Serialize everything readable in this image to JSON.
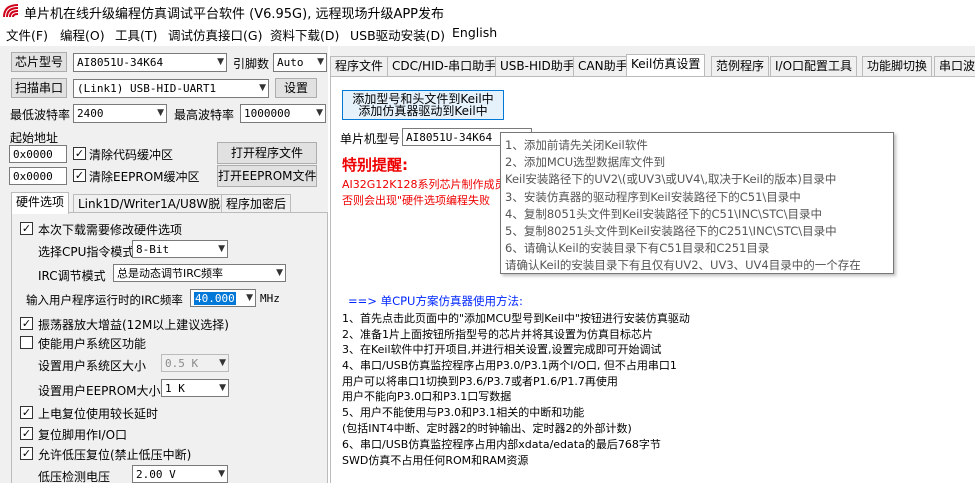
{
  "window": {
    "title": "单片机在线升级编程仿真调试平台软件 (V6.95G), 远程现场升级APP发布"
  },
  "menu": [
    "文件(F)",
    "编程(O)",
    "工具(T)",
    "调试仿真接口(G)",
    "资料下载(D)",
    "USB驱动安装(D)",
    "English"
  ],
  "left": {
    "chip_btn": "芯片型号",
    "chip_value": "AI8051U-34K64",
    "pins_label": "引脚数",
    "pins_value": "Auto",
    "scan_btn": "扫描串口",
    "port_value": "(Link1) USB-HID-UART1",
    "settings_btn": "设置",
    "min_baud_label": "最低波特率",
    "min_baud": "2400",
    "max_baud_label": "最高波特率",
    "max_baud": "1000000",
    "start_addr_label": "起始地址",
    "addr1": "0x0000",
    "clear_code": "清除代码缓冲区",
    "open_prog": "打开程序文件",
    "addr2": "0x0000",
    "clear_eeprom": "清除EEPROM缓冲区",
    "open_eeprom": "打开EEPROM文件",
    "subtabs": [
      "硬件选项",
      "Link1D/Writer1A/U8W脱机",
      "程序加密后"
    ],
    "opt_modify": "本次下载需要修改硬件选项",
    "cpu_label": "选择CPU指令模式",
    "cpu_value": "8-Bit",
    "irc_label": "IRC调节模式",
    "irc_value": "总是动态调节IRC频率",
    "freq_label": "输入用户程序运行时的IRC频率",
    "freq_value": "40.000",
    "freq_unit": "MHz",
    "amp": "振荡器放大增益(12M以上建议选择)",
    "sys_area": "使能用户系统区功能",
    "sys_size_label": "设置用户系统区大小",
    "sys_size": "0.5 K",
    "eeprom_label": "设置用户EEPROM大小",
    "eeprom_size": "1   K",
    "long_delay": "上电复位使用较长延时",
    "reset_io": "复位脚用作I/O口",
    "lvr": "允许低压复位(禁止低压中断)",
    "lv_label": "低压检测电压",
    "lv_value": "2.00 V"
  },
  "right": {
    "tabs": [
      "程序文件",
      "CDC/HID-串口助手",
      "USB-HID助手",
      "CAN助手",
      "Keil仿真设置",
      "范例程序",
      "I/O口配置工具",
      "功能脚切换",
      "串口波"
    ],
    "add_btn_line1": "添加型号和头文件到Keil中",
    "add_btn_line2": "添加仿真器驱动到Keil中",
    "mcu_label": "单片机型号",
    "mcu_value": "AI8051U-34K64",
    "warn_title": "特别提醒:",
    "warn_line1": "AI32G12K128系列芯片制作成员",
    "warn_line2": "否则会出现\"硬件选项编程失败",
    "method": "==> 单CPU方案仿真器使用方法:",
    "steps": [
      "1、首先点击此页面中的\"添加MCU型号到Keil中\"按钮进行安装仿真驱动",
      "2、准备1片上面按钮所指型号的芯片并将其设置为仿真目标芯片",
      "3、在Keil软件中打开项目,并进行相关设置,设置完成即可开始调试",
      "4、串口/USB仿真监控程序占用P3.0/P3.1两个I/O口, 但不占用串口1",
      "    用户可以将串口1切换到P3.6/P3.7或者P1.6/P1.7再使用",
      "    用户不能向P3.0口和P3.1口写数据",
      "5、用户不能使用与P3.0和P3.1相关的中断和功能",
      "    (包括INT4中断、定时器2的时钟输出、定时器2的外部计数)",
      "6、串口/USB仿真监控程序占用内部xdata/edata的最后768字节",
      "    SWD仿真不占用任何ROM和RAM资源"
    ]
  },
  "tooltip": {
    "lines": [
      "1、添加前请先关闭Keil软件",
      "2、添加MCU选型数据库文件到",
      "     Keil安装路径下的UV2\\(或UV3\\或UV4\\,取决于Keil的版本)目录中",
      "3、安装仿真器的驱动程序到Keil安装路径下的C51\\目录中",
      "4、复制8051头文件到Keil安装路径下的C51\\INC\\STC\\目录中",
      "5、复制80251头文件到Keil安装路径下的C251\\INC\\STC\\目录中",
      "6、请确认Keil的安装目录下有C51目录和C251目录",
      "     请确认Keil的安装目录下有且仅有UV2、UV3、UV4目录中的一个存在"
    ]
  }
}
